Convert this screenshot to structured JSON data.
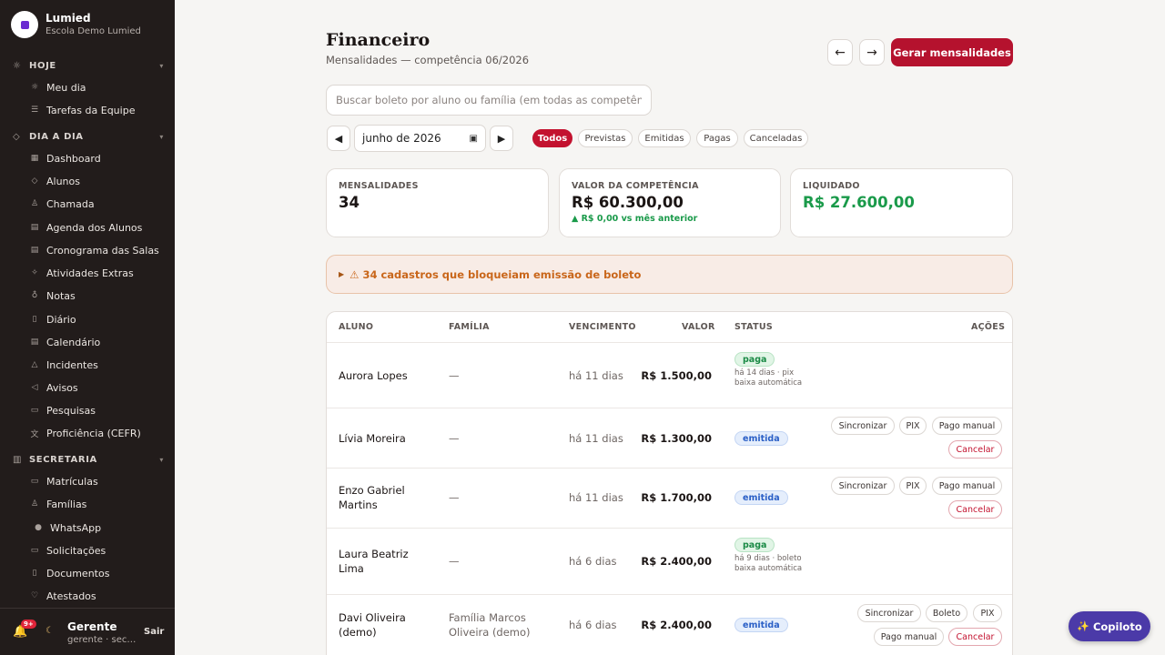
{
  "brand": {
    "name": "Lumied",
    "subtitle": "Escola Demo Lumied",
    "logo_text": "Lumied"
  },
  "sidebar": {
    "sections": [
      {
        "label": "HOJE",
        "icon": "sun-icon",
        "items": [
          {
            "label": "Meu dia",
            "icon": "sun-icon"
          },
          {
            "label": "Tarefas da Equipe",
            "icon": "checklist-icon"
          }
        ]
      },
      {
        "label": "DIA A DIA",
        "icon": "graduation-cap-icon",
        "items": [
          {
            "label": "Dashboard",
            "icon": "grid-icon"
          },
          {
            "label": "Alunos",
            "icon": "graduation-cap-icon"
          },
          {
            "label": "Chamada",
            "icon": "user-check-icon"
          },
          {
            "label": "Agenda dos Alunos",
            "icon": "calendar-icon"
          },
          {
            "label": "Cronograma das Salas",
            "icon": "calendar-icon"
          },
          {
            "label": "Atividades Extras",
            "icon": "sparkle-icon"
          },
          {
            "label": "Notas",
            "icon": "ribbon-icon"
          },
          {
            "label": "Diário",
            "icon": "book-icon"
          },
          {
            "label": "Calendário",
            "icon": "calendar-icon"
          },
          {
            "label": "Incidentes",
            "icon": "warning-icon"
          },
          {
            "label": "Avisos",
            "icon": "megaphone-icon"
          },
          {
            "label": "Pesquisas",
            "icon": "clipboard-icon"
          },
          {
            "label": "Proficiência (CEFR)",
            "icon": "translate-icon"
          }
        ]
      },
      {
        "label": "SECRETARIA",
        "icon": "building-icon",
        "items": [
          {
            "label": "Matrículas",
            "icon": "clipboard-icon"
          },
          {
            "label": "Famílias",
            "icon": "users-icon"
          },
          {
            "label": "WhatsApp",
            "icon": "chat-icon"
          },
          {
            "label": "Solicitações",
            "icon": "message-icon"
          },
          {
            "label": "Documentos",
            "icon": "document-icon"
          },
          {
            "label": "Atestados",
            "icon": "stethoscope-icon"
          }
        ]
      }
    ],
    "footer": {
      "notifications_badge": "9+",
      "user_name": "Gerente",
      "user_role": "gerente · secretaria",
      "logout_label": "Sair"
    }
  },
  "header": {
    "title": "Financeiro",
    "subtitle": "Mensalidades — competência 06/2026",
    "prev_label": "←",
    "next_label": "→",
    "primary_button": "Gerar mensalidades"
  },
  "search": {
    "placeholder": "Buscar boleto por aluno ou família (em todas as competências)"
  },
  "period": {
    "prev": "◀",
    "next": "▶",
    "month": "junho de 2026"
  },
  "filters": [
    {
      "label": "Todos",
      "active": true
    },
    {
      "label": "Previstas",
      "active": false
    },
    {
      "label": "Emitidas",
      "active": false
    },
    {
      "label": "Pagas",
      "active": false
    },
    {
      "label": "Canceladas",
      "active": false
    }
  ],
  "kpis": [
    {
      "label": "MENSALIDADES",
      "value": "34"
    },
    {
      "label": "VALOR DA COMPETÊNCIA",
      "value": "R$ 60.300,00",
      "delta": "▲ R$ 0,00 vs mês anterior"
    },
    {
      "label": "LIQUIDADO",
      "value": "R$ 27.600,00"
    }
  ],
  "alert": {
    "toggle": "▶",
    "text": "⚠ 34 cadastros que bloqueiam emissão de boleto"
  },
  "table": {
    "columns": [
      "ALUNO",
      "FAMÍLIA",
      "VENCIMENTO",
      "VALOR",
      "STATUS",
      "AÇÕES"
    ],
    "rows": [
      {
        "aluno": "Aurora Lopes",
        "familia": "—",
        "vencimento": "há 11 dias",
        "valor": "R$ 1.500,00",
        "status": "paga",
        "status_note": "há 14 dias · pix baixa automática",
        "actions": []
      },
      {
        "aluno": "Lívia Moreira",
        "familia": "—",
        "vencimento": "há 11 dias",
        "valor": "R$ 1.300,00",
        "status": "emitida",
        "actions": [
          "Sincronizar",
          "PIX",
          "Pago manual",
          "Cancelar"
        ]
      },
      {
        "aluno": "Enzo Gabriel Martins",
        "familia": "—",
        "vencimento": "há 11 dias",
        "valor": "R$ 1.700,00",
        "status": "emitida",
        "actions": [
          "Sincronizar",
          "PIX",
          "Pago manual",
          "Cancelar"
        ]
      },
      {
        "aluno": "Laura Beatriz Lima",
        "familia": "—",
        "vencimento": "há 6 dias",
        "valor": "R$ 2.400,00",
        "status": "paga",
        "status_note": "há 9 dias · boleto baixa automática",
        "actions": []
      },
      {
        "aluno": "Davi Oliveira (demo)",
        "familia": "Família Marcos Oliveira (demo)",
        "vencimento": "há 6 dias",
        "valor": "R$ 2.400,00",
        "status": "emitida",
        "actions": [
          "Sincronizar",
          "Boleto",
          "PIX",
          "Pago manual",
          "Cancelar"
        ]
      }
    ]
  },
  "copilot": {
    "icon": "✨",
    "label": "Copiloto"
  }
}
